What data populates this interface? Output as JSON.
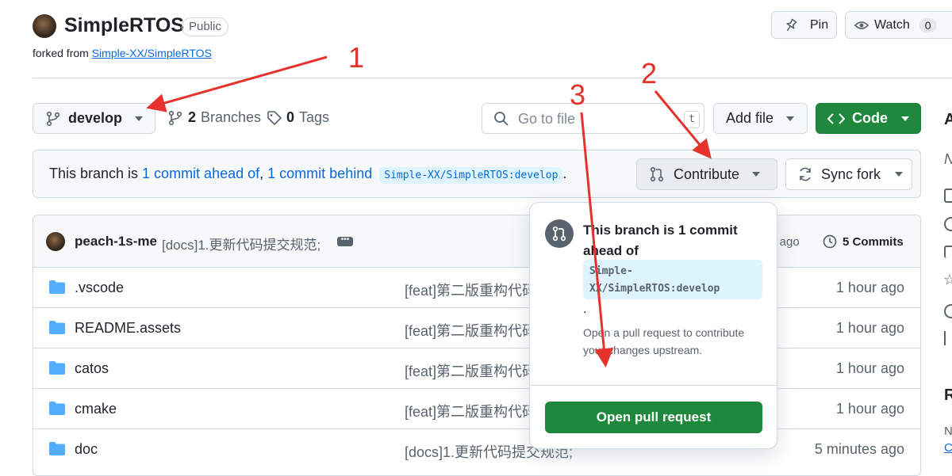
{
  "repo": {
    "name": "SimpleRTOS",
    "visibility": "Public",
    "forked_prefix": "forked from ",
    "forked_from": "Simple-XX/SimpleRTOS",
    "pin_label": "Pin",
    "watch_label": "Watch",
    "watch_count": "0"
  },
  "toolbar": {
    "branch": "develop",
    "branches_count": "2",
    "branches_label": "Branches",
    "tags_count": "0",
    "tags_label": "Tags",
    "goto_placeholder": "Go to file",
    "goto_shortcut": "t",
    "add_file_label": "Add file",
    "code_label": "Code"
  },
  "banner": {
    "prefix": "This branch is ",
    "ahead_link": "1 commit ahead of",
    "sep": ",",
    "behind_link": "1 commit behind",
    "target": "Simple-XX/SimpleRTOS:develop",
    "suffix": ".",
    "contribute_label": "Contribute",
    "sync_label": "Sync fork"
  },
  "latest_commit": {
    "author": "peach-1s-me",
    "message": "[docs]1.更新代码提交规范;",
    "time_partial": "s ago",
    "commits_label": "5 Commits"
  },
  "files": [
    {
      "name": ".vscode",
      "message": "[feat]第二版重构代码",
      "time": "1 hour ago"
    },
    {
      "name": "README.assets",
      "message": "[feat]第二版重构代码",
      "time": "1 hour ago"
    },
    {
      "name": "catos",
      "message": "[feat]第二版重构代码",
      "time": "1 hour ago"
    },
    {
      "name": "cmake",
      "message": "[feat]第二版重构代码",
      "time": "1 hour ago"
    },
    {
      "name": "doc",
      "message": "[docs]1.更新代码提交规范;",
      "time": "5 minutes ago"
    }
  ],
  "popover": {
    "heading_line1": "This branch is 1 commit",
    "heading_line2": "ahead of",
    "target_line1": "Simple-",
    "target_line2": "XX/SimpleRTOS:develop",
    "dot": ".",
    "desc_line1": "Open a pull request to contribute",
    "desc_line2": "your changes upstream.",
    "button_label": "Open pull request"
  },
  "annotations": {
    "n1": "1",
    "n2": "2",
    "n3": "3",
    "color": "#e5322d"
  },
  "sidebar": {
    "char_top": "A",
    "char_n": "N",
    "char_r": "R",
    "char_n2": "N",
    "char_c": "C"
  }
}
